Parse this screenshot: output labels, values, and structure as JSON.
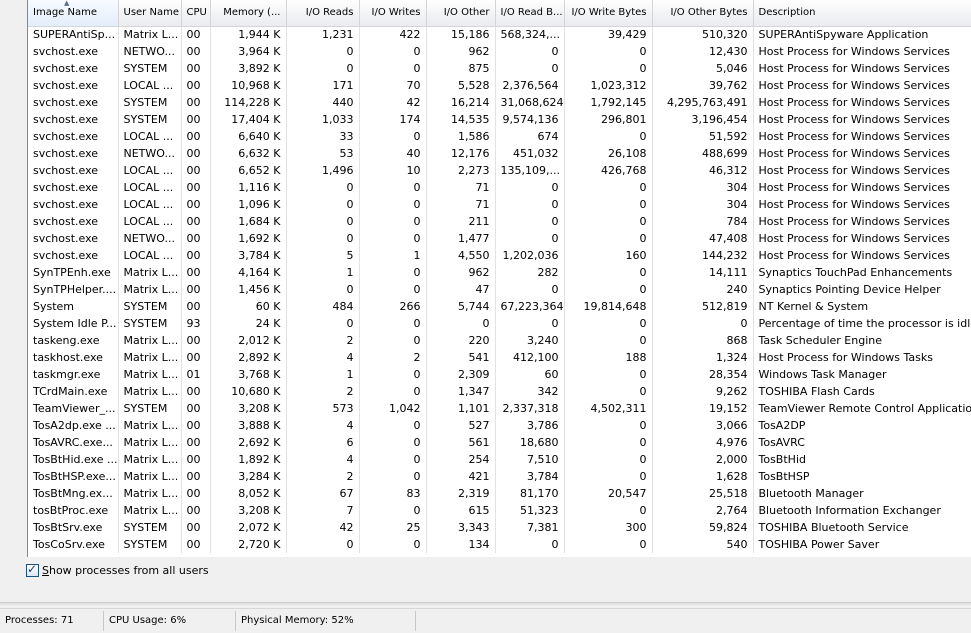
{
  "columns": [
    "Image Name",
    "User Name",
    "CPU",
    "Memory (...",
    "I/O Reads",
    "I/O Writes",
    "I/O Other",
    "I/O Read B...",
    "I/O Write Bytes",
    "I/O Other Bytes",
    "Description"
  ],
  "rows": [
    [
      "SUPERAntiSp...",
      "Matrix L...",
      "00",
      "1,944 K",
      "1,231",
      "422",
      "15,186",
      "568,324,...",
      "39,429",
      "510,320",
      "SUPERAntiSpyware Application"
    ],
    [
      "svchost.exe",
      "NETWO...",
      "00",
      "3,964 K",
      "0",
      "0",
      "962",
      "0",
      "0",
      "12,430",
      "Host Process for Windows Services"
    ],
    [
      "svchost.exe",
      "SYSTEM",
      "00",
      "3,892 K",
      "0",
      "0",
      "875",
      "0",
      "0",
      "5,046",
      "Host Process for Windows Services"
    ],
    [
      "svchost.exe",
      "LOCAL ...",
      "00",
      "10,968 K",
      "171",
      "70",
      "5,528",
      "2,376,564",
      "1,023,312",
      "39,762",
      "Host Process for Windows Services"
    ],
    [
      "svchost.exe",
      "SYSTEM",
      "00",
      "114,228 K",
      "440",
      "42",
      "16,214",
      "31,068,624",
      "1,792,145",
      "4,295,763,491",
      "Host Process for Windows Services"
    ],
    [
      "svchost.exe",
      "SYSTEM",
      "00",
      "17,404 K",
      "1,033",
      "174",
      "14,535",
      "9,574,136",
      "296,801",
      "3,196,454",
      "Host Process for Windows Services"
    ],
    [
      "svchost.exe",
      "LOCAL ...",
      "00",
      "6,640 K",
      "33",
      "0",
      "1,586",
      "674",
      "0",
      "51,592",
      "Host Process for Windows Services"
    ],
    [
      "svchost.exe",
      "NETWO...",
      "00",
      "6,632 K",
      "53",
      "40",
      "12,176",
      "451,032",
      "26,108",
      "488,699",
      "Host Process for Windows Services"
    ],
    [
      "svchost.exe",
      "LOCAL ...",
      "00",
      "6,652 K",
      "1,496",
      "10",
      "2,273",
      "135,109,...",
      "426,768",
      "46,312",
      "Host Process for Windows Services"
    ],
    [
      "svchost.exe",
      "LOCAL ...",
      "00",
      "1,116 K",
      "0",
      "0",
      "71",
      "0",
      "0",
      "304",
      "Host Process for Windows Services"
    ],
    [
      "svchost.exe",
      "LOCAL ...",
      "00",
      "1,096 K",
      "0",
      "0",
      "71",
      "0",
      "0",
      "304",
      "Host Process for Windows Services"
    ],
    [
      "svchost.exe",
      "LOCAL ...",
      "00",
      "1,684 K",
      "0",
      "0",
      "211",
      "0",
      "0",
      "784",
      "Host Process for Windows Services"
    ],
    [
      "svchost.exe",
      "NETWO...",
      "00",
      "1,692 K",
      "0",
      "0",
      "1,477",
      "0",
      "0",
      "47,408",
      "Host Process for Windows Services"
    ],
    [
      "svchost.exe",
      "LOCAL ...",
      "00",
      "3,784 K",
      "5",
      "1",
      "4,550",
      "1,202,036",
      "160",
      "144,232",
      "Host Process for Windows Services"
    ],
    [
      "SynTPEnh.exe",
      "Matrix L...",
      "00",
      "4,164 K",
      "1",
      "0",
      "962",
      "282",
      "0",
      "14,111",
      "Synaptics TouchPad Enhancements"
    ],
    [
      "SynTPHelper....",
      "Matrix L...",
      "00",
      "1,456 K",
      "0",
      "0",
      "47",
      "0",
      "0",
      "240",
      "Synaptics Pointing Device Helper"
    ],
    [
      "System",
      "SYSTEM",
      "00",
      "60 K",
      "484",
      "266",
      "5,744",
      "67,223,364",
      "19,814,648",
      "512,819",
      "NT Kernel & System"
    ],
    [
      "System Idle P...",
      "SYSTEM",
      "93",
      "24 K",
      "0",
      "0",
      "0",
      "0",
      "0",
      "0",
      "Percentage of time the processor is idle"
    ],
    [
      "taskeng.exe",
      "Matrix L...",
      "00",
      "2,012 K",
      "2",
      "0",
      "220",
      "3,240",
      "0",
      "868",
      "Task Scheduler Engine"
    ],
    [
      "taskhost.exe",
      "Matrix L...",
      "00",
      "2,892 K",
      "4",
      "2",
      "541",
      "412,100",
      "188",
      "1,324",
      "Host Process for Windows Tasks"
    ],
    [
      "taskmgr.exe",
      "Matrix L...",
      "01",
      "3,768 K",
      "1",
      "0",
      "2,309",
      "60",
      "0",
      "28,354",
      "Windows Task Manager"
    ],
    [
      "TCrdMain.exe",
      "Matrix L...",
      "00",
      "10,680 K",
      "2",
      "0",
      "1,347",
      "342",
      "0",
      "9,262",
      "TOSHIBA Flash Cards"
    ],
    [
      "TeamViewer_...",
      "SYSTEM",
      "00",
      "3,208 K",
      "573",
      "1,042",
      "1,101",
      "2,337,318",
      "4,502,311",
      "19,152",
      "TeamViewer Remote Control Application"
    ],
    [
      "TosA2dp.exe ...",
      "Matrix L...",
      "00",
      "3,888 K",
      "4",
      "0",
      "527",
      "3,786",
      "0",
      "3,066",
      "TosA2DP"
    ],
    [
      "TosAVRC.exe...",
      "Matrix L...",
      "00",
      "2,692 K",
      "6",
      "0",
      "561",
      "18,680",
      "0",
      "4,976",
      "TosAVRC"
    ],
    [
      "TosBtHid.exe ...",
      "Matrix L...",
      "00",
      "1,892 K",
      "4",
      "0",
      "254",
      "7,510",
      "0",
      "2,000",
      "TosBtHid"
    ],
    [
      "TosBtHSP.exe...",
      "Matrix L...",
      "00",
      "3,284 K",
      "2",
      "0",
      "421",
      "3,784",
      "0",
      "1,628",
      "TosBtHSP"
    ],
    [
      "TosBtMng.ex...",
      "Matrix L...",
      "00",
      "8,052 K",
      "67",
      "83",
      "2,319",
      "81,170",
      "20,547",
      "25,518",
      "Bluetooth Manager"
    ],
    [
      "tosBtProc.exe",
      "Matrix L...",
      "00",
      "3,208 K",
      "7",
      "0",
      "615",
      "51,323",
      "0",
      "2,764",
      "Bluetooth Information Exchanger"
    ],
    [
      "TosBtSrv.exe",
      "SYSTEM",
      "00",
      "2,072 K",
      "42",
      "25",
      "3,343",
      "7,381",
      "300",
      "59,824",
      "TOSHIBA Bluetooth Service"
    ],
    [
      "TosCoSrv.exe",
      "SYSTEM",
      "00",
      "2,720 K",
      "0",
      "0",
      "134",
      "0",
      "0",
      "540",
      "TOSHIBA Power Saver"
    ]
  ],
  "show_all": {
    "checked": true,
    "accel_char": "S",
    "label_rest": "how processes from all users"
  },
  "statusbar": {
    "processes": "Processes: 71",
    "cpu": "CPU Usage: 6%",
    "memory": "Physical Memory: 52%"
  }
}
